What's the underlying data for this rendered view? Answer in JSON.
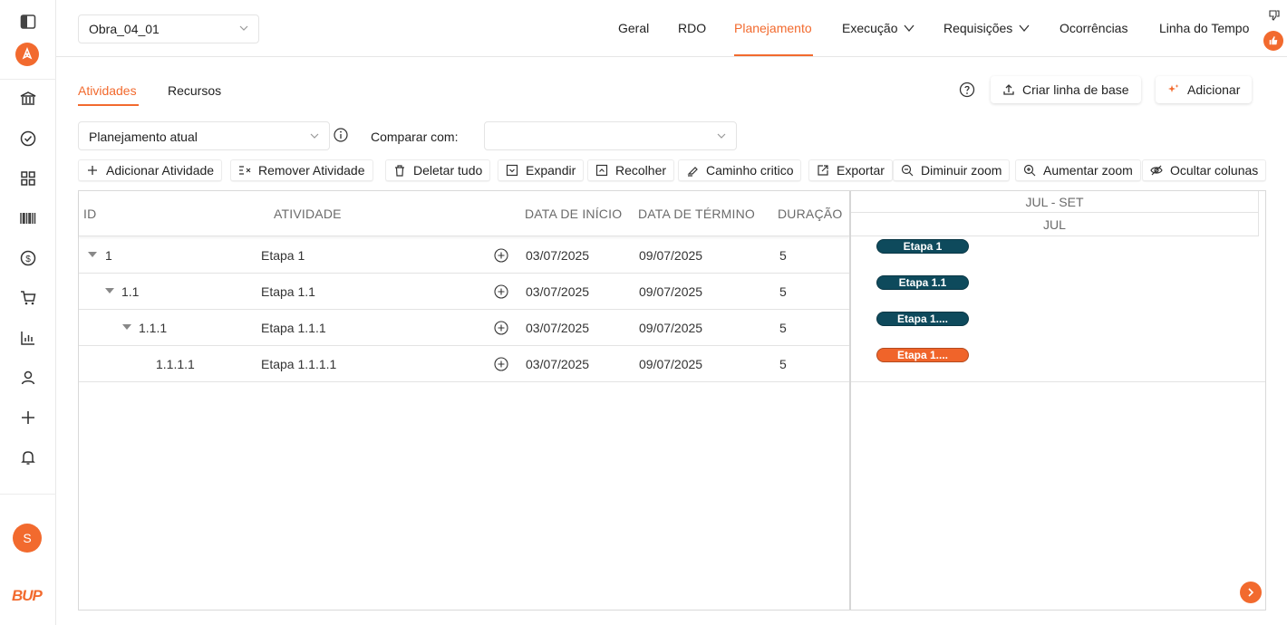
{
  "project": {
    "selected": "Obra_04_01"
  },
  "nav": [
    {
      "label": "Geral"
    },
    {
      "label": "RDO"
    },
    {
      "label": "Planejamento"
    },
    {
      "label": "Execução"
    },
    {
      "label": "Requisições"
    },
    {
      "label": "Ocorrências"
    },
    {
      "label": "Linha do Tempo"
    }
  ],
  "tabs": [
    {
      "label": "Atividades"
    },
    {
      "label": "Recursos"
    }
  ],
  "header_actions": {
    "baseline_label": "Criar linha de base",
    "add_label": "Adicionar"
  },
  "planning": {
    "select_value": "Planejamento atual",
    "compare_label": "Comparar com:",
    "compare_value": ""
  },
  "toolbar": [
    {
      "label": "Adicionar Atividade",
      "icon": "plus-icon"
    },
    {
      "label": "Remover Atividade",
      "icon": "remove-indent-icon"
    },
    {
      "label": "Deletar tudo",
      "icon": "trash-icon"
    },
    {
      "label": "Expandir",
      "icon": "expand-icon"
    },
    {
      "label": "Recolher",
      "icon": "collapse-icon"
    },
    {
      "label": "Caminho critico",
      "icon": "highlighter-icon"
    },
    {
      "label": "Exportar",
      "icon": "export-icon"
    },
    {
      "label": "Diminuir zoom",
      "icon": "zoom-out-icon"
    },
    {
      "label": "Aumentar zoom",
      "icon": "zoom-in-icon"
    },
    {
      "label": "Ocultar colunas",
      "icon": "eye-off-icon"
    }
  ],
  "grid": {
    "columns": {
      "id": "ID",
      "activity": "ATIVIDADE",
      "start": "DATA DE INÍCIO",
      "end": "DATA DE TÉRMINO",
      "duration": "DURAÇÃO"
    },
    "rows": [
      {
        "id": "1",
        "activity": "Etapa 1",
        "start": "03/07/2025",
        "end": "09/07/2025",
        "duration": "5"
      },
      {
        "id": "1.1",
        "activity": "Etapa 1.1",
        "start": "03/07/2025",
        "end": "09/07/2025",
        "duration": "5"
      },
      {
        "id": "1.1.1",
        "activity": "Etapa 1.1.1",
        "start": "03/07/2025",
        "end": "09/07/2025",
        "duration": "5"
      },
      {
        "id": "1.1.1.1",
        "activity": "Etapa 1.1.1.1",
        "start": "03/07/2025",
        "end": "09/07/2025",
        "duration": "5"
      }
    ]
  },
  "gantt": {
    "period_label": "JUL - SET",
    "month_label": "JUL",
    "bars": [
      {
        "label": "Etapa 1",
        "color": "#0e4a5c"
      },
      {
        "label": "Etapa 1.1",
        "color": "#0e4a5c"
      },
      {
        "label": "Etapa 1....",
        "color": "#0e4a5c"
      },
      {
        "label": "Etapa 1....",
        "color": "#f0642a"
      }
    ]
  },
  "user": {
    "initial": "S"
  },
  "brand": {
    "name": "BUP"
  },
  "colors": {
    "accent": "#f26a2e",
    "bar_summary": "#0e4a5c"
  }
}
